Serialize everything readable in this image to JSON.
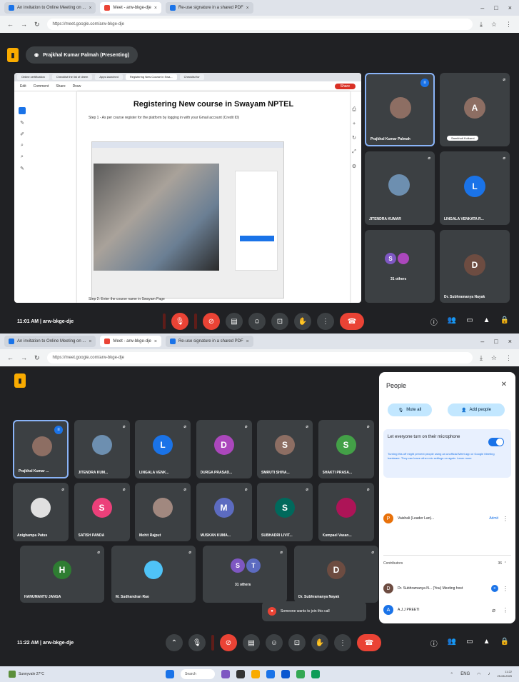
{
  "colors": {
    "meet_bg": "#202124",
    "tile_bg": "#3c4043",
    "accent_blue": "#1a73e8",
    "hangup_red": "#ea4335",
    "meet_logo": "#f9ab00"
  },
  "screen1": {
    "tabs": [
      "An invitation to Online Meeting on ...",
      "Meet - arw-bkge-dje",
      "Re-use signature in a shared PDF"
    ],
    "url": "https://meet.google.com/arw-bkge-dje",
    "presenter_label": "Prajkhal Kumar Palmah (Presenting)",
    "doc": {
      "tabs": [
        "Online certification",
        "Checklist the list of deem",
        "Apps launched",
        "Registering New Course in Swa...",
        "Checklist for"
      ],
      "menu": [
        "Edit",
        "Comment",
        "Share",
        "Draw"
      ],
      "share_label": "Share",
      "title": "Registering New course in Swayam NPTEL",
      "step_text": "Step 1 - As per course register for the platform by logging in with your Gmail account (Credit ID)",
      "footer_text": "Step 2: Enter the course name in Swayam Page"
    },
    "participants": [
      {
        "name": "Prajkhal Kumar Palmah",
        "initial": "",
        "color": "#8d6e63",
        "speaking": true
      },
      {
        "name": "",
        "initial": "A",
        "color": "#8d6e63",
        "pill": "Sambhuti Kulkarni"
      },
      {
        "name": "JITENDRA KUMAR",
        "initial": "",
        "color": "#6d8fb0"
      },
      {
        "name": "LINGALA VENKATA R...",
        "initial": "L",
        "color": "#1a73e8"
      },
      {
        "name": "31 others",
        "initial": "S",
        "color": "#7e57c2"
      },
      {
        "name": "Dr. Subhramanya Nayak",
        "initial": "D",
        "color": "#6d4c41"
      }
    ],
    "time": "11:01 AM",
    "meeting_code": "arw-bkge-dje"
  },
  "screen2": {
    "tabs": [
      "An invitation to Online Meeting on ...",
      "Meet - arw-bkge-dje",
      "Re-use signature in a shared PDF"
    ],
    "url": "https://meet.google.com/arw-bkge-dje",
    "participants": [
      {
        "name": "Prajkhal Kumar ...",
        "initial": "",
        "color": "#8d6e63",
        "speaking": true
      },
      {
        "name": "JITENDRA KUM...",
        "initial": "",
        "color": "#6d8fb0"
      },
      {
        "name": "LINGALA VENK...",
        "initial": "L",
        "color": "#1a73e8"
      },
      {
        "name": "DURGA PRASAD...",
        "initial": "D",
        "color": "#ab47bc"
      },
      {
        "name": "SMRUTI SHIVA...",
        "initial": "S",
        "color": "#8d6e63"
      },
      {
        "name": "SHAKTI PRASA...",
        "initial": "S",
        "color": "#43a047"
      },
      {
        "name": "Anighampa Patus",
        "initial": "",
        "color": "#e0e0e0"
      },
      {
        "name": "SATISH PANDA",
        "initial": "S",
        "color": "#ec407a"
      },
      {
        "name": "Mohit Rajput",
        "initial": "",
        "color": "#a1887f"
      },
      {
        "name": "MUSKAN KUMA...",
        "initial": "M",
        "color": "#5c6bc0"
      },
      {
        "name": "SUBHADRI LIVIT...",
        "initial": "S",
        "color": "#00695c"
      },
      {
        "name": "Kumpael Vasan...",
        "initial": "",
        "color": "#ad1457"
      },
      {
        "name": "HANUMANTU JANGA",
        "initial": "H",
        "color": "#2e7d32"
      },
      {
        "name": "M. Sudhandran Rao",
        "initial": "",
        "color": "#4fc3f7"
      },
      {
        "name": "31 others",
        "initial": "S",
        "color": "#7e57c2"
      },
      {
        "name": "Dr. Subhramanya Nayak",
        "initial": "D",
        "color": "#6d4c41"
      }
    ],
    "people_panel": {
      "title": "People",
      "mute_all": "Mute all",
      "add_people": "Add people",
      "turn_on_mic_label": "Let everyone turn on their microphone",
      "turn_on_mic_help": "Turning this off might prevent people using an unofficial Meet app or Google Meeting hardware. They can leave other mic settings on again.",
      "learn_more": "Learn more",
      "host_row": {
        "name": "Vaishali (Leader Lan)...",
        "initial": "P",
        "color": "#e8710a",
        "extra": "Admit"
      },
      "contributors_label": "Contributors",
      "contributors_count": "36",
      "rows": [
        {
          "name": "Dr. Subhramanya N... (You) Meeting host",
          "initial": "D",
          "color": "#6d4c41"
        },
        {
          "name": "A.J.J PREETI",
          "initial": "A",
          "color": "#1a73e8"
        }
      ]
    },
    "toast": "Someone wants to join this call",
    "time": "11:22 AM",
    "meeting_code": "arw-bkge-dje"
  },
  "taskbar": {
    "weather": "Sunnyvale 27°C",
    "search": "Search",
    "clock_time": "11:22",
    "clock_date": "25-08-2025",
    "lang": "ENG"
  }
}
